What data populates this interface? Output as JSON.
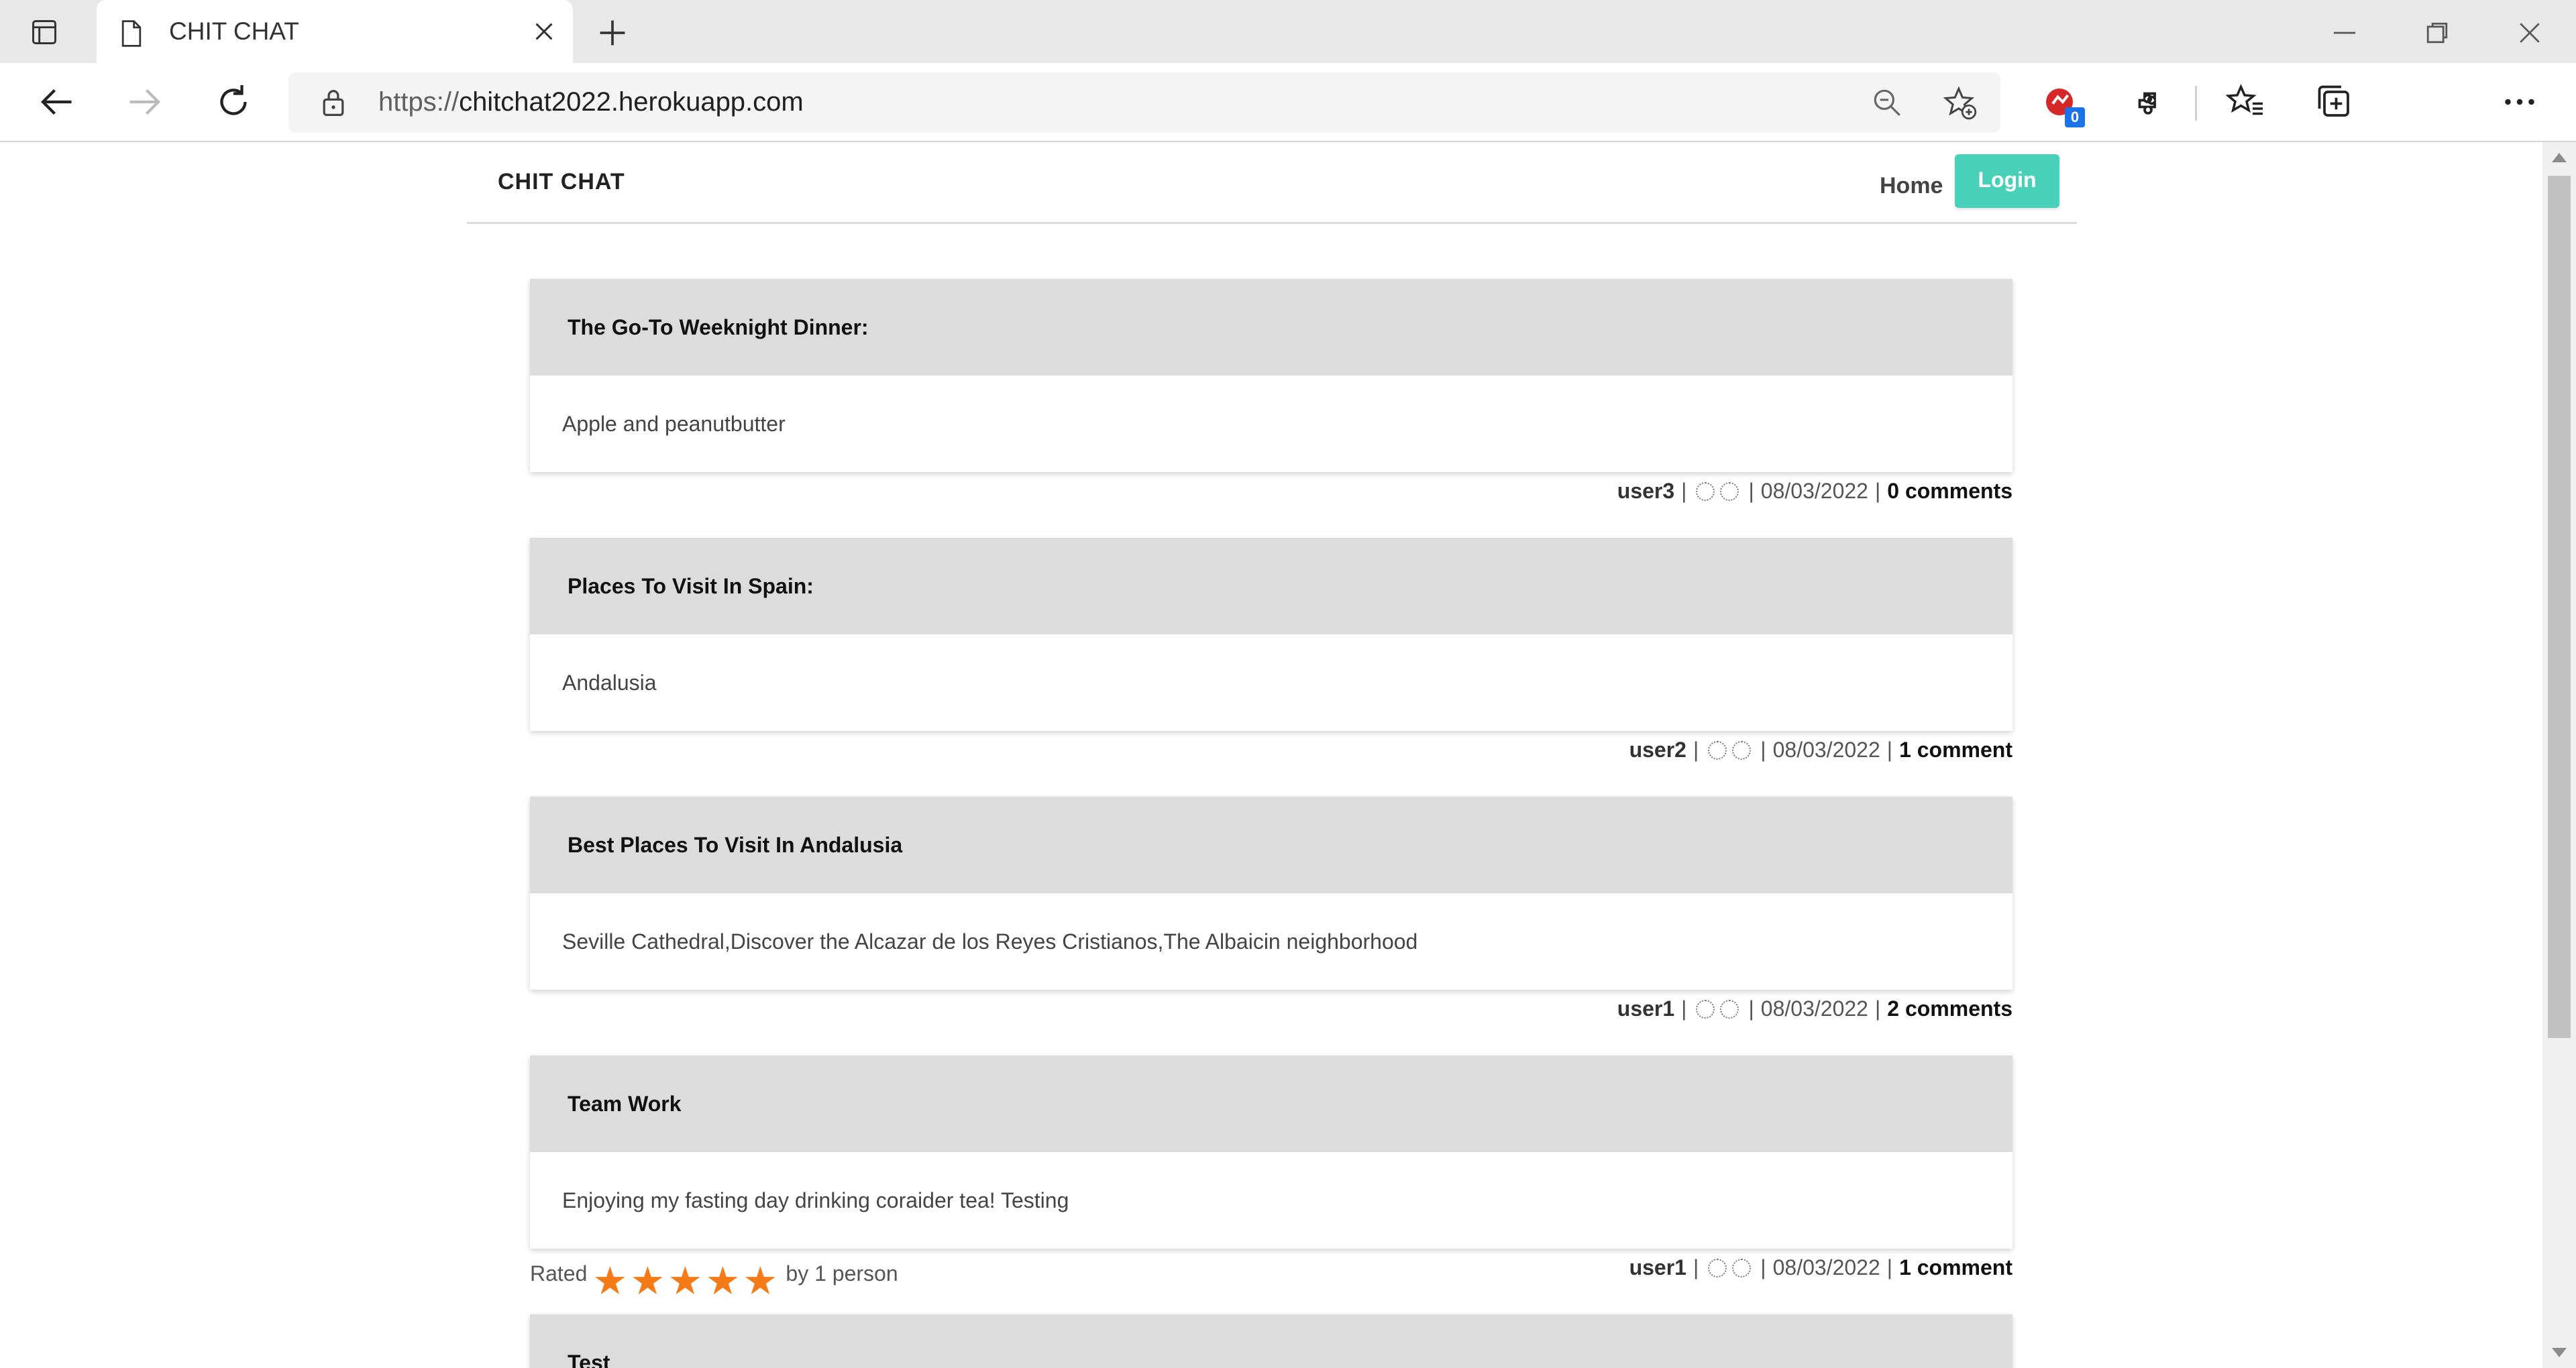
{
  "browser": {
    "tab_title": "CHIT CHAT",
    "url_scheme": "https://",
    "url_host": "chitchat2022.herokuapp.com",
    "extension_badge": "0"
  },
  "site": {
    "brand": "CHIT CHAT",
    "nav_home": "Home",
    "login": "Login",
    "accent_color": "#48d0b8",
    "star_color": "#f47b16"
  },
  "posts": [
    {
      "title": "The Go-To Weeknight Dinner:",
      "body": "Apple and peanutbutter",
      "author": "user3",
      "date": "08/03/2022",
      "comments": "0 comments"
    },
    {
      "title": "Places To Visit In Spain:",
      "body": "Andalusia",
      "author": "user2",
      "date": "08/03/2022",
      "comments": "1 comment"
    },
    {
      "title": "Best Places To Visit In Andalusia",
      "body": "Seville Cathedral,Discover the Alcazar de los Reyes Cristianos,The Albaicin neighborhood",
      "author": "user1",
      "date": "08/03/2022",
      "comments": "2 comments"
    },
    {
      "title": "Team Work",
      "body": "Enjoying my fasting day drinking coraider tea! Testing",
      "author": "user1",
      "date": "08/03/2022",
      "comments": "1 comment",
      "rating": {
        "prefix": "Rated",
        "stars": 5,
        "suffix": "by 1 person"
      }
    },
    {
      "title": "Test"
    }
  ]
}
